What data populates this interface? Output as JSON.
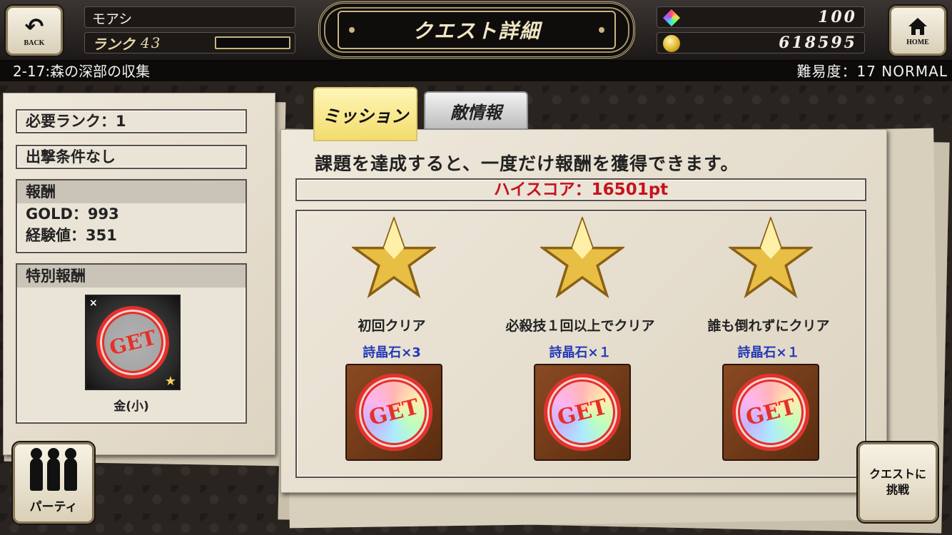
{
  "top_bar": {
    "back_label": "BACK",
    "home_label": "HOME",
    "player_name": "モアシ",
    "rank_label": "ランク",
    "rank_value": "43",
    "rank_exp_fraction": 0.0,
    "screen_title": "クエスト詳細",
    "gems": "100",
    "gold": "618595"
  },
  "sub_bar": {
    "stage": "2-17:森の深部の収集",
    "difficulty": "難易度：17 NORMAL"
  },
  "left_panel": {
    "required_rank": "必要ランク：1",
    "condition": "出撃条件なし",
    "reward_header": "報酬",
    "reward_gold": "GOLD：993",
    "reward_exp": "経験値：351",
    "special_header": "特別報酬",
    "special_item_name": "金(小)",
    "special_item_stamp": "GET",
    "special_item_badge": "×"
  },
  "party_button": {
    "label": "パーティ"
  },
  "tabs": [
    {
      "label": "ミッション",
      "active": true
    },
    {
      "label": "敵情報",
      "active": false
    }
  ],
  "missions_panel": {
    "description": "課題を達成すると、一度だけ報酬を獲得できます。",
    "high_score": "ハイスコア：16501pt",
    "missions": [
      {
        "label": "初回クリア",
        "reward": "詩晶石×3",
        "stamp": "GET"
      },
      {
        "label": "必殺技１回以上でクリア",
        "reward": "詩晶石×１",
        "stamp": "GET"
      },
      {
        "label": "誰も倒れずにクリア",
        "reward": "詩晶石×１",
        "stamp": "GET"
      }
    ]
  },
  "challenge_button": {
    "label": "クエストに挑戦"
  },
  "icons": {
    "back": "back-arrow-icon",
    "home": "home-icon",
    "gem": "crystal-gem-icon",
    "coin": "gold-coin-icon",
    "star": "gold-star-icon",
    "party": "party-members-icon"
  },
  "colors": {
    "accent_gold": "#c9b483",
    "high_score": "#c4141e",
    "reward_text": "#2238b8",
    "stamp_red": "#e4312a",
    "active_tab": "#f3dc6c"
  }
}
